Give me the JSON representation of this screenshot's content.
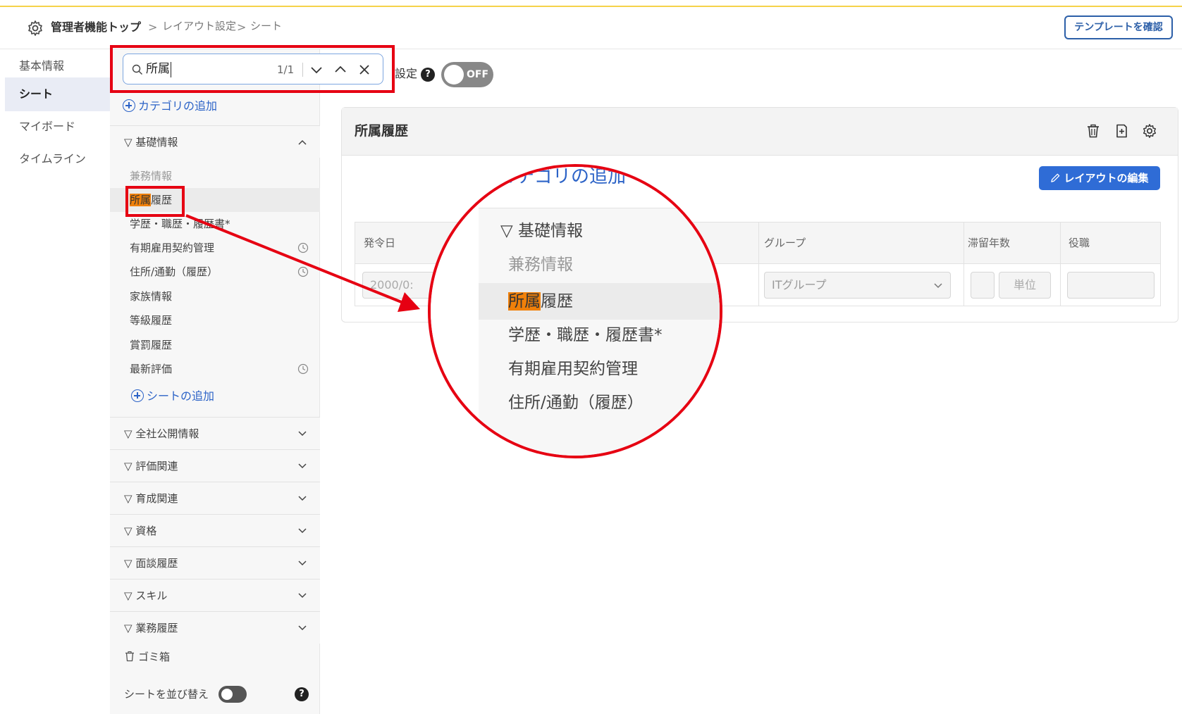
{
  "header": {
    "crumb_home": "管理者機能トップ",
    "crumb_layout": "レイアウト設定",
    "crumb_sheet": "シート",
    "sep": ">",
    "template_button": "テンプレートを確認"
  },
  "leftnav": {
    "items": [
      {
        "label": "基本情報"
      },
      {
        "label": "シート"
      },
      {
        "label": "マイボード"
      },
      {
        "label": "タイムライン"
      }
    ]
  },
  "search": {
    "value": "所属",
    "count": "1/1"
  },
  "sheetpanel": {
    "add_category": "カテゴリの追加",
    "expanded_category": "基礎情報",
    "sheets": [
      {
        "label": "兼務情報"
      },
      {
        "label_hl": "所属",
        "label_rest": "履歴"
      },
      {
        "label": "学歴・職歴・履歴書*"
      },
      {
        "label": "有期雇用契約管理"
      },
      {
        "label": "住所/通勤（履歴）"
      },
      {
        "label": "家族情報"
      },
      {
        "label": "等級履歴"
      },
      {
        "label": "賞罰履歴"
      },
      {
        "label": "最新評価"
      }
    ],
    "add_sheet": "シートの追加",
    "categories": [
      {
        "label": "全社公開情報"
      },
      {
        "label": "評価関連"
      },
      {
        "label": "育成関連"
      },
      {
        "label": "資格"
      },
      {
        "label": "面談履歴"
      },
      {
        "label": "スキル"
      },
      {
        "label": "業務履歴"
      }
    ],
    "trash": "ゴミ箱",
    "sort_label": "シートを並び替え",
    "help": "?"
  },
  "main": {
    "setting_text": "設定",
    "help": "?",
    "toggle_text": "OFF",
    "card_title": "所属履歴",
    "edit_button": "レイアウトの編集",
    "columns": [
      "発令日",
      "グループ",
      "滞留年数",
      "役職"
    ],
    "row": {
      "date_placeholder": "2000/0:",
      "group_value": "ITグループ",
      "unit_placeholder": "単位"
    }
  },
  "zoom": {
    "add_category": "カテゴリの追加",
    "category": "▽ 基礎情報",
    "items": [
      {
        "label": "兼務情報"
      },
      {
        "label_hl": "所属",
        "label_rest": "履歴"
      },
      {
        "label": "学歴・職歴・履歴書*"
      },
      {
        "label": "有期雇用契約管理"
      },
      {
        "label": "住所/通勤（履歴）"
      }
    ]
  },
  "colors": {
    "accent": "#2c63c7",
    "highlight": "#f0800a",
    "annotation_red": "#e60012"
  }
}
